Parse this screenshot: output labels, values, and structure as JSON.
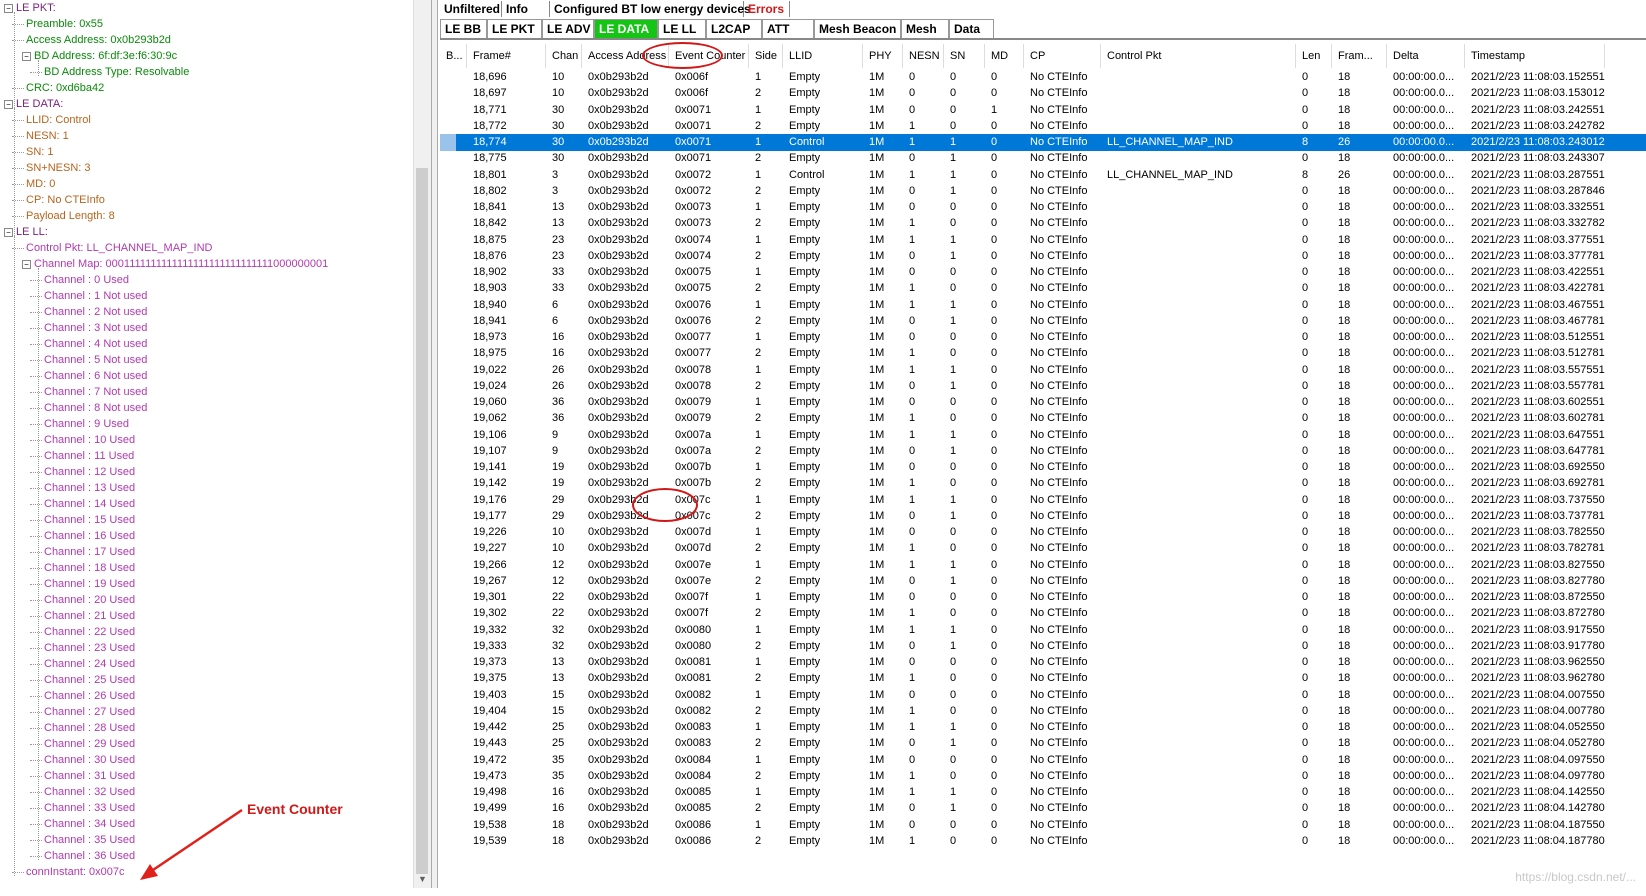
{
  "tree": [
    {
      "text": "LE PKT:",
      "depth": 0,
      "color": "#7a1e7a",
      "expand": "-"
    },
    {
      "text": "Preamble: 0x55",
      "depth": 1,
      "color": "#0a8a0a"
    },
    {
      "text": "Access Address: 0x0b293b2d",
      "depth": 1,
      "color": "#0a8a0a"
    },
    {
      "text": "BD Address: 6f:df:3e:f6:30:9c",
      "depth": 1,
      "color": "#0a8a0a",
      "expand": "-"
    },
    {
      "text": "BD Address Type: Resolvable",
      "depth": 2,
      "color": "#0a8a0a"
    },
    {
      "text": "CRC: 0xd6ba42",
      "depth": 1,
      "color": "#0a8a0a"
    },
    {
      "text": "LE DATA:",
      "depth": 0,
      "color": "#7a1e7a",
      "expand": "-"
    },
    {
      "text": "LLID: Control",
      "depth": 1,
      "color": "#b5651d"
    },
    {
      "text": "NESN: 1",
      "depth": 1,
      "color": "#b5651d"
    },
    {
      "text": "SN: 1",
      "depth": 1,
      "color": "#b5651d"
    },
    {
      "text": "SN+NESN: 3",
      "depth": 1,
      "color": "#b5651d"
    },
    {
      "text": "MD: 0",
      "depth": 1,
      "color": "#b5651d"
    },
    {
      "text": "CP: No CTEInfo",
      "depth": 1,
      "color": "#b5651d"
    },
    {
      "text": "Payload Length: 8",
      "depth": 1,
      "color": "#b5651d"
    },
    {
      "text": "LE LL:",
      "depth": 0,
      "color": "#7a1e7a",
      "expand": "-"
    },
    {
      "text": "Control Pkt: LL_CHANNEL_MAP_IND",
      "depth": 1,
      "color": "#b03ab0"
    },
    {
      "text": "Channel Map: 0001111111111111111111111111111000000001",
      "depth": 1,
      "color": "#b03ab0",
      "expand": "-"
    },
    {
      "text": "Channel : 0 Used",
      "depth": 2,
      "color": "#b03ab0"
    },
    {
      "text": "Channel : 1 Not used",
      "depth": 2,
      "color": "#b03ab0"
    },
    {
      "text": "Channel : 2 Not used",
      "depth": 2,
      "color": "#b03ab0"
    },
    {
      "text": "Channel : 3 Not used",
      "depth": 2,
      "color": "#b03ab0"
    },
    {
      "text": "Channel : 4 Not used",
      "depth": 2,
      "color": "#b03ab0"
    },
    {
      "text": "Channel : 5 Not used",
      "depth": 2,
      "color": "#b03ab0"
    },
    {
      "text": "Channel : 6 Not used",
      "depth": 2,
      "color": "#b03ab0"
    },
    {
      "text": "Channel : 7 Not used",
      "depth": 2,
      "color": "#b03ab0"
    },
    {
      "text": "Channel : 8 Not used",
      "depth": 2,
      "color": "#b03ab0"
    },
    {
      "text": "Channel : 9 Used",
      "depth": 2,
      "color": "#b03ab0"
    },
    {
      "text": "Channel : 10 Used",
      "depth": 2,
      "color": "#b03ab0"
    },
    {
      "text": "Channel : 11 Used",
      "depth": 2,
      "color": "#b03ab0"
    },
    {
      "text": "Channel : 12 Used",
      "depth": 2,
      "color": "#b03ab0"
    },
    {
      "text": "Channel : 13 Used",
      "depth": 2,
      "color": "#b03ab0"
    },
    {
      "text": "Channel : 14 Used",
      "depth": 2,
      "color": "#b03ab0"
    },
    {
      "text": "Channel : 15 Used",
      "depth": 2,
      "color": "#b03ab0"
    },
    {
      "text": "Channel : 16 Used",
      "depth": 2,
      "color": "#b03ab0"
    },
    {
      "text": "Channel : 17 Used",
      "depth": 2,
      "color": "#b03ab0"
    },
    {
      "text": "Channel : 18 Used",
      "depth": 2,
      "color": "#b03ab0"
    },
    {
      "text": "Channel : 19 Used",
      "depth": 2,
      "color": "#b03ab0"
    },
    {
      "text": "Channel : 20 Used",
      "depth": 2,
      "color": "#b03ab0"
    },
    {
      "text": "Channel : 21 Used",
      "depth": 2,
      "color": "#b03ab0"
    },
    {
      "text": "Channel : 22 Used",
      "depth": 2,
      "color": "#b03ab0"
    },
    {
      "text": "Channel : 23 Used",
      "depth": 2,
      "color": "#b03ab0"
    },
    {
      "text": "Channel : 24 Used",
      "depth": 2,
      "color": "#b03ab0"
    },
    {
      "text": "Channel : 25 Used",
      "depth": 2,
      "color": "#b03ab0"
    },
    {
      "text": "Channel : 26 Used",
      "depth": 2,
      "color": "#b03ab0"
    },
    {
      "text": "Channel : 27 Used",
      "depth": 2,
      "color": "#b03ab0"
    },
    {
      "text": "Channel : 28 Used",
      "depth": 2,
      "color": "#b03ab0"
    },
    {
      "text": "Channel : 29 Used",
      "depth": 2,
      "color": "#b03ab0"
    },
    {
      "text": "Channel : 30 Used",
      "depth": 2,
      "color": "#b03ab0"
    },
    {
      "text": "Channel : 31 Used",
      "depth": 2,
      "color": "#b03ab0"
    },
    {
      "text": "Channel : 32 Used",
      "depth": 2,
      "color": "#b03ab0"
    },
    {
      "text": "Channel : 33 Used",
      "depth": 2,
      "color": "#b03ab0"
    },
    {
      "text": "Channel : 34 Used",
      "depth": 2,
      "color": "#b03ab0"
    },
    {
      "text": "Channel : 35 Used",
      "depth": 2,
      "color": "#b03ab0"
    },
    {
      "text": "Channel : 36 Used",
      "depth": 2,
      "color": "#b03ab0"
    },
    {
      "text": "connInstant: 0x007c",
      "depth": 1,
      "color": "#b03ab0"
    }
  ],
  "tabs_top": [
    {
      "label": "Unfiltered"
    },
    {
      "label": "Info"
    },
    {
      "label": "Configured BT low energy devices"
    },
    {
      "label": "Errors",
      "color": "#d01818"
    }
  ],
  "tabs_bottom": [
    {
      "label": "LE BB"
    },
    {
      "label": "LE PKT"
    },
    {
      "label": "LE ADV"
    },
    {
      "label": "LE DATA",
      "active": true
    },
    {
      "label": "LE LL"
    },
    {
      "label": "L2CAP"
    },
    {
      "label": "ATT"
    },
    {
      "label": "Mesh Beacon"
    },
    {
      "label": "Mesh"
    },
    {
      "label": "Data"
    }
  ],
  "columns": [
    "B...",
    "Frame#",
    "Chan",
    "Access Address",
    "Event Counter",
    "Side",
    "LLID",
    "PHY",
    "NESN",
    "SN",
    "MD",
    "CP",
    "Control Pkt",
    "Len",
    "Fram...",
    "Delta",
    "Timestamp"
  ],
  "rows": [
    [
      "18,696",
      "10",
      "0x0b293b2d",
      "0x006f",
      "1",
      "Empty",
      "1M",
      "0",
      "0",
      "0",
      "No CTEInfo",
      "",
      "0",
      "18",
      "00:00:00.0...",
      "2021/2/23 11:08:03.152551"
    ],
    [
      "18,697",
      "10",
      "0x0b293b2d",
      "0x006f",
      "2",
      "Empty",
      "1M",
      "0",
      "0",
      "0",
      "No CTEInfo",
      "",
      "0",
      "18",
      "00:00:00.0...",
      "2021/2/23 11:08:03.153012"
    ],
    [
      "18,771",
      "30",
      "0x0b293b2d",
      "0x0071",
      "1",
      "Empty",
      "1M",
      "0",
      "0",
      "1",
      "No CTEInfo",
      "",
      "0",
      "18",
      "00:00:00.0...",
      "2021/2/23 11:08:03.242551"
    ],
    [
      "18,772",
      "30",
      "0x0b293b2d",
      "0x0071",
      "2",
      "Empty",
      "1M",
      "1",
      "0",
      "0",
      "No CTEInfo",
      "",
      "0",
      "18",
      "00:00:00.0...",
      "2021/2/23 11:08:03.242782"
    ],
    [
      "18,774",
      "30",
      "0x0b293b2d",
      "0x0071",
      "1",
      "Control",
      "1M",
      "1",
      "1",
      "0",
      "No CTEInfo",
      "LL_CHANNEL_MAP_IND",
      "8",
      "26",
      "00:00:00.0...",
      "2021/2/23 11:08:03.243012"
    ],
    [
      "18,775",
      "30",
      "0x0b293b2d",
      "0x0071",
      "2",
      "Empty",
      "1M",
      "0",
      "1",
      "0",
      "No CTEInfo",
      "",
      "0",
      "18",
      "00:00:00.0...",
      "2021/2/23 11:08:03.243307"
    ],
    [
      "18,801",
      "3",
      "0x0b293b2d",
      "0x0072",
      "1",
      "Control",
      "1M",
      "1",
      "1",
      "0",
      "No CTEInfo",
      "LL_CHANNEL_MAP_IND",
      "8",
      "26",
      "00:00:00.0...",
      "2021/2/23 11:08:03.287551"
    ],
    [
      "18,802",
      "3",
      "0x0b293b2d",
      "0x0072",
      "2",
      "Empty",
      "1M",
      "0",
      "1",
      "0",
      "No CTEInfo",
      "",
      "0",
      "18",
      "00:00:00.0...",
      "2021/2/23 11:08:03.287846"
    ],
    [
      "18,841",
      "13",
      "0x0b293b2d",
      "0x0073",
      "1",
      "Empty",
      "1M",
      "0",
      "0",
      "0",
      "No CTEInfo",
      "",
      "0",
      "18",
      "00:00:00.0...",
      "2021/2/23 11:08:03.332551"
    ],
    [
      "18,842",
      "13",
      "0x0b293b2d",
      "0x0073",
      "2",
      "Empty",
      "1M",
      "1",
      "0",
      "0",
      "No CTEInfo",
      "",
      "0",
      "18",
      "00:00:00.0...",
      "2021/2/23 11:08:03.332782"
    ],
    [
      "18,875",
      "23",
      "0x0b293b2d",
      "0x0074",
      "1",
      "Empty",
      "1M",
      "1",
      "1",
      "0",
      "No CTEInfo",
      "",
      "0",
      "18",
      "00:00:00.0...",
      "2021/2/23 11:08:03.377551"
    ],
    [
      "18,876",
      "23",
      "0x0b293b2d",
      "0x0074",
      "2",
      "Empty",
      "1M",
      "0",
      "1",
      "0",
      "No CTEInfo",
      "",
      "0",
      "18",
      "00:00:00.0...",
      "2021/2/23 11:08:03.377781"
    ],
    [
      "18,902",
      "33",
      "0x0b293b2d",
      "0x0075",
      "1",
      "Empty",
      "1M",
      "0",
      "0",
      "0",
      "No CTEInfo",
      "",
      "0",
      "18",
      "00:00:00.0...",
      "2021/2/23 11:08:03.422551"
    ],
    [
      "18,903",
      "33",
      "0x0b293b2d",
      "0x0075",
      "2",
      "Empty",
      "1M",
      "1",
      "0",
      "0",
      "No CTEInfo",
      "",
      "0",
      "18",
      "00:00:00.0...",
      "2021/2/23 11:08:03.422781"
    ],
    [
      "18,940",
      "6",
      "0x0b293b2d",
      "0x0076",
      "1",
      "Empty",
      "1M",
      "1",
      "1",
      "0",
      "No CTEInfo",
      "",
      "0",
      "18",
      "00:00:00.0...",
      "2021/2/23 11:08:03.467551"
    ],
    [
      "18,941",
      "6",
      "0x0b293b2d",
      "0x0076",
      "2",
      "Empty",
      "1M",
      "0",
      "1",
      "0",
      "No CTEInfo",
      "",
      "0",
      "18",
      "00:00:00.0...",
      "2021/2/23 11:08:03.467781"
    ],
    [
      "18,973",
      "16",
      "0x0b293b2d",
      "0x0077",
      "1",
      "Empty",
      "1M",
      "0",
      "0",
      "0",
      "No CTEInfo",
      "",
      "0",
      "18",
      "00:00:00.0...",
      "2021/2/23 11:08:03.512551"
    ],
    [
      "18,975",
      "16",
      "0x0b293b2d",
      "0x0077",
      "2",
      "Empty",
      "1M",
      "1",
      "0",
      "0",
      "No CTEInfo",
      "",
      "0",
      "18",
      "00:00:00.0...",
      "2021/2/23 11:08:03.512781"
    ],
    [
      "19,022",
      "26",
      "0x0b293b2d",
      "0x0078",
      "1",
      "Empty",
      "1M",
      "1",
      "1",
      "0",
      "No CTEInfo",
      "",
      "0",
      "18",
      "00:00:00.0...",
      "2021/2/23 11:08:03.557551"
    ],
    [
      "19,024",
      "26",
      "0x0b293b2d",
      "0x0078",
      "2",
      "Empty",
      "1M",
      "0",
      "1",
      "0",
      "No CTEInfo",
      "",
      "0",
      "18",
      "00:00:00.0...",
      "2021/2/23 11:08:03.557781"
    ],
    [
      "19,060",
      "36",
      "0x0b293b2d",
      "0x0079",
      "1",
      "Empty",
      "1M",
      "0",
      "0",
      "0",
      "No CTEInfo",
      "",
      "0",
      "18",
      "00:00:00.0...",
      "2021/2/23 11:08:03.602551"
    ],
    [
      "19,062",
      "36",
      "0x0b293b2d",
      "0x0079",
      "2",
      "Empty",
      "1M",
      "1",
      "0",
      "0",
      "No CTEInfo",
      "",
      "0",
      "18",
      "00:00:00.0...",
      "2021/2/23 11:08:03.602781"
    ],
    [
      "19,106",
      "9",
      "0x0b293b2d",
      "0x007a",
      "1",
      "Empty",
      "1M",
      "1",
      "1",
      "0",
      "No CTEInfo",
      "",
      "0",
      "18",
      "00:00:00.0...",
      "2021/2/23 11:08:03.647551"
    ],
    [
      "19,107",
      "9",
      "0x0b293b2d",
      "0x007a",
      "2",
      "Empty",
      "1M",
      "0",
      "1",
      "0",
      "No CTEInfo",
      "",
      "0",
      "18",
      "00:00:00.0...",
      "2021/2/23 11:08:03.647781"
    ],
    [
      "19,141",
      "19",
      "0x0b293b2d",
      "0x007b",
      "1",
      "Empty",
      "1M",
      "0",
      "0",
      "0",
      "No CTEInfo",
      "",
      "0",
      "18",
      "00:00:00.0...",
      "2021/2/23 11:08:03.692550"
    ],
    [
      "19,142",
      "19",
      "0x0b293b2d",
      "0x007b",
      "2",
      "Empty",
      "1M",
      "1",
      "0",
      "0",
      "No CTEInfo",
      "",
      "0",
      "18",
      "00:00:00.0...",
      "2021/2/23 11:08:03.692781"
    ],
    [
      "19,176",
      "29",
      "0x0b293b2d",
      "0x007c",
      "1",
      "Empty",
      "1M",
      "1",
      "1",
      "0",
      "No CTEInfo",
      "",
      "0",
      "18",
      "00:00:00.0...",
      "2021/2/23 11:08:03.737550"
    ],
    [
      "19,177",
      "29",
      "0x0b293b2d",
      "0x007c",
      "2",
      "Empty",
      "1M",
      "0",
      "1",
      "0",
      "No CTEInfo",
      "",
      "0",
      "18",
      "00:00:00.0...",
      "2021/2/23 11:08:03.737781"
    ],
    [
      "19,226",
      "10",
      "0x0b293b2d",
      "0x007d",
      "1",
      "Empty",
      "1M",
      "0",
      "0",
      "0",
      "No CTEInfo",
      "",
      "0",
      "18",
      "00:00:00.0...",
      "2021/2/23 11:08:03.782550"
    ],
    [
      "19,227",
      "10",
      "0x0b293b2d",
      "0x007d",
      "2",
      "Empty",
      "1M",
      "1",
      "0",
      "0",
      "No CTEInfo",
      "",
      "0",
      "18",
      "00:00:00.0...",
      "2021/2/23 11:08:03.782781"
    ],
    [
      "19,266",
      "12",
      "0x0b293b2d",
      "0x007e",
      "1",
      "Empty",
      "1M",
      "1",
      "1",
      "0",
      "No CTEInfo",
      "",
      "0",
      "18",
      "00:00:00.0...",
      "2021/2/23 11:08:03.827550"
    ],
    [
      "19,267",
      "12",
      "0x0b293b2d",
      "0x007e",
      "2",
      "Empty",
      "1M",
      "0",
      "1",
      "0",
      "No CTEInfo",
      "",
      "0",
      "18",
      "00:00:00.0...",
      "2021/2/23 11:08:03.827780"
    ],
    [
      "19,301",
      "22",
      "0x0b293b2d",
      "0x007f",
      "1",
      "Empty",
      "1M",
      "0",
      "0",
      "0",
      "No CTEInfo",
      "",
      "0",
      "18",
      "00:00:00.0...",
      "2021/2/23 11:08:03.872550"
    ],
    [
      "19,302",
      "22",
      "0x0b293b2d",
      "0x007f",
      "2",
      "Empty",
      "1M",
      "1",
      "0",
      "0",
      "No CTEInfo",
      "",
      "0",
      "18",
      "00:00:00.0...",
      "2021/2/23 11:08:03.872780"
    ],
    [
      "19,332",
      "32",
      "0x0b293b2d",
      "0x0080",
      "1",
      "Empty",
      "1M",
      "1",
      "1",
      "0",
      "No CTEInfo",
      "",
      "0",
      "18",
      "00:00:00.0...",
      "2021/2/23 11:08:03.917550"
    ],
    [
      "19,333",
      "32",
      "0x0b293b2d",
      "0x0080",
      "2",
      "Empty",
      "1M",
      "0",
      "1",
      "0",
      "No CTEInfo",
      "",
      "0",
      "18",
      "00:00:00.0...",
      "2021/2/23 11:08:03.917780"
    ],
    [
      "19,373",
      "13",
      "0x0b293b2d",
      "0x0081",
      "1",
      "Empty",
      "1M",
      "0",
      "0",
      "0",
      "No CTEInfo",
      "",
      "0",
      "18",
      "00:00:00.0...",
      "2021/2/23 11:08:03.962550"
    ],
    [
      "19,375",
      "13",
      "0x0b293b2d",
      "0x0081",
      "2",
      "Empty",
      "1M",
      "1",
      "0",
      "0",
      "No CTEInfo",
      "",
      "0",
      "18",
      "00:00:00.0...",
      "2021/2/23 11:08:03.962780"
    ],
    [
      "19,403",
      "15",
      "0x0b293b2d",
      "0x0082",
      "1",
      "Empty",
      "1M",
      "0",
      "0",
      "0",
      "No CTEInfo",
      "",
      "0",
      "18",
      "00:00:00.0...",
      "2021/2/23 11:08:04.007550"
    ],
    [
      "19,404",
      "15",
      "0x0b293b2d",
      "0x0082",
      "2",
      "Empty",
      "1M",
      "1",
      "0",
      "0",
      "No CTEInfo",
      "",
      "0",
      "18",
      "00:00:00.0...",
      "2021/2/23 11:08:04.007780"
    ],
    [
      "19,442",
      "25",
      "0x0b293b2d",
      "0x0083",
      "1",
      "Empty",
      "1M",
      "1",
      "1",
      "0",
      "No CTEInfo",
      "",
      "0",
      "18",
      "00:00:00.0...",
      "2021/2/23 11:08:04.052550"
    ],
    [
      "19,443",
      "25",
      "0x0b293b2d",
      "0x0083",
      "2",
      "Empty",
      "1M",
      "0",
      "1",
      "0",
      "No CTEInfo",
      "",
      "0",
      "18",
      "00:00:00.0...",
      "2021/2/23 11:08:04.052780"
    ],
    [
      "19,472",
      "35",
      "0x0b293b2d",
      "0x0084",
      "1",
      "Empty",
      "1M",
      "0",
      "0",
      "0",
      "No CTEInfo",
      "",
      "0",
      "18",
      "00:00:00.0...",
      "2021/2/23 11:08:04.097550"
    ],
    [
      "19,473",
      "35",
      "0x0b293b2d",
      "0x0084",
      "2",
      "Empty",
      "1M",
      "1",
      "0",
      "0",
      "No CTEInfo",
      "",
      "0",
      "18",
      "00:00:00.0...",
      "2021/2/23 11:08:04.097780"
    ],
    [
      "19,498",
      "16",
      "0x0b293b2d",
      "0x0085",
      "1",
      "Empty",
      "1M",
      "1",
      "1",
      "0",
      "No CTEInfo",
      "",
      "0",
      "18",
      "00:00:00.0...",
      "2021/2/23 11:08:04.142550"
    ],
    [
      "19,499",
      "16",
      "0x0b293b2d",
      "0x0085",
      "2",
      "Empty",
      "1M",
      "0",
      "1",
      "0",
      "No CTEInfo",
      "",
      "0",
      "18",
      "00:00:00.0...",
      "2021/2/23 11:08:04.142780"
    ],
    [
      "19,538",
      "18",
      "0x0b293b2d",
      "0x0086",
      "1",
      "Empty",
      "1M",
      "0",
      "0",
      "0",
      "No CTEInfo",
      "",
      "0",
      "18",
      "00:00:00.0...",
      "2021/2/23 11:08:04.187550"
    ],
    [
      "19,539",
      "18",
      "0x0b293b2d",
      "0x0086",
      "2",
      "Empty",
      "1M",
      "1",
      "0",
      "0",
      "No CTEInfo",
      "",
      "0",
      "18",
      "00:00:00.0...",
      "2021/2/23 11:08:04.187780"
    ]
  ],
  "selected_row": 4,
  "annotation": {
    "label": "Event Counter",
    "color": "#d01818"
  },
  "watermark": "https://blog.csdn.net/..."
}
